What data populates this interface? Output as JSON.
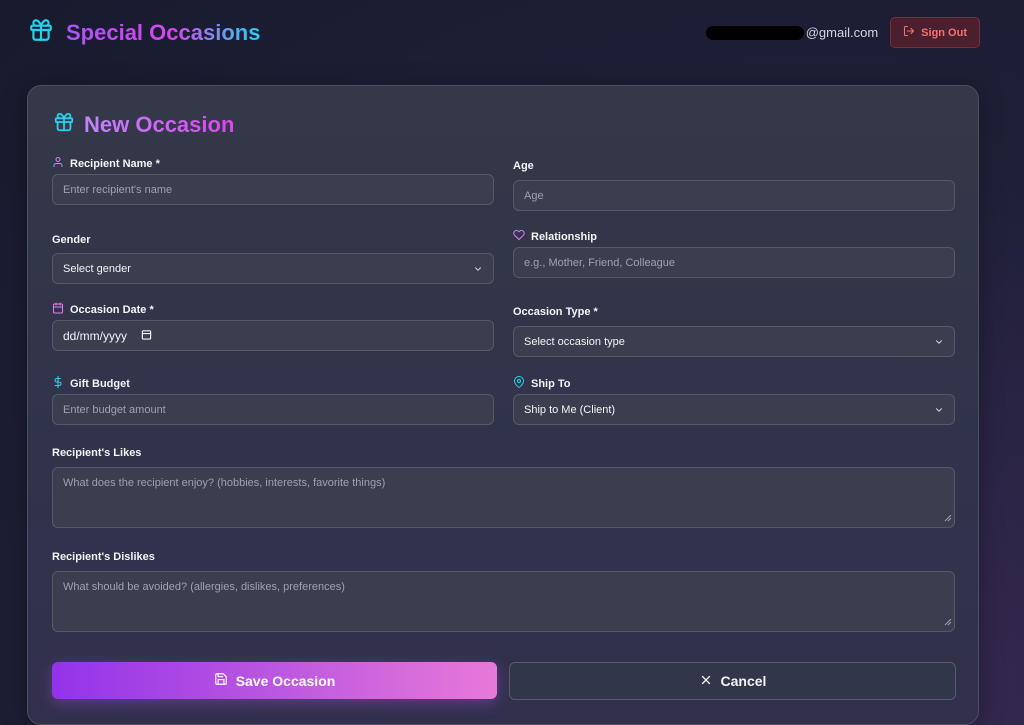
{
  "header": {
    "title": "Special Occasions",
    "email_suffix": "@gmail.com",
    "sign_out_label": "Sign Out"
  },
  "form": {
    "title": "New Occasion",
    "recipient_name": {
      "label": "Recipient Name *",
      "placeholder": "Enter recipient's name"
    },
    "age": {
      "label": "Age",
      "placeholder": "Age"
    },
    "gender": {
      "label": "Gender",
      "value": "Select gender"
    },
    "relationship": {
      "label": "Relationship",
      "placeholder": "e.g., Mother, Friend, Colleague"
    },
    "occasion_date": {
      "label": "Occasion Date *",
      "value": "dd/mm/yyyy"
    },
    "occasion_type": {
      "label": "Occasion Type *",
      "value": "Select occasion type"
    },
    "gift_budget": {
      "label": "Gift Budget",
      "placeholder": "Enter budget amount"
    },
    "ship_to": {
      "label": "Ship To",
      "value": "Ship to Me (Client)"
    },
    "likes": {
      "label": "Recipient's Likes",
      "placeholder": "What does the recipient enjoy? (hobbies, interests, favorite things)"
    },
    "dislikes": {
      "label": "Recipient's Dislikes",
      "placeholder": "What should be avoided? (allergies, dislikes, preferences)"
    },
    "save_label": "Save Occasion",
    "cancel_label": "Cancel"
  },
  "icons": {
    "brand": "gift-icon",
    "sign_out": "log-out-icon",
    "recipient": "user-icon",
    "relationship": "heart-icon",
    "date": "calendar-icon",
    "budget": "dollar-icon",
    "ship": "map-pin-icon",
    "save": "save-icon",
    "cancel": "x-icon"
  },
  "colors": {
    "accent_purple": "#a855f7",
    "accent_pink": "#d946ef",
    "accent_cyan": "#22d3ee",
    "danger": "#f87171"
  }
}
